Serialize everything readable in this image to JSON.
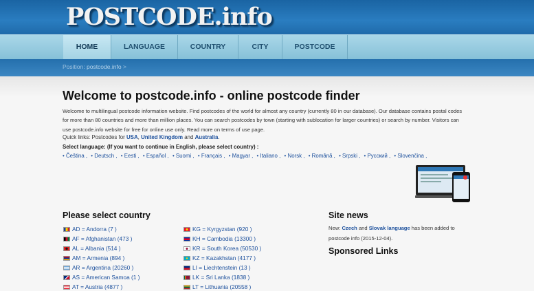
{
  "logo": "POSTCODE.info",
  "nav": [
    {
      "label": "HOME"
    },
    {
      "label": "LANGUAGE"
    },
    {
      "label": "COUNTRY"
    },
    {
      "label": "CITY"
    },
    {
      "label": "POSTCODE"
    }
  ],
  "breadcrumb": {
    "prefix": "Position:",
    "link": "postcode.info",
    "sep": ">"
  },
  "heading": "Welcome to postcode.info - online postcode finder",
  "intro": "Welcome to multilingual postcode information website. Find postcodes of the world for almost any country (currently 80 in our database). Our database contains postal codes for more than 80 countries and more than million places. You can search postcodes by town (starting with sublocation for larger countries) or search by number. Visitors can use postcode.info website for free for online use only. Read more on terms of use page.",
  "quick_links": {
    "prefix": "Quick links: Postcodes for",
    "usa": "USA",
    "uk": "United Kingdom",
    "and": "and",
    "aus": "Australia",
    "end": "."
  },
  "select_language": "Select language: (If you want to continue in English, please select country) :",
  "languages": [
    {
      "label": "• Čeština ,"
    },
    {
      "label": "• Deutsch ,"
    },
    {
      "label": "• Eesti ,"
    },
    {
      "label": "• Español ,"
    },
    {
      "label": "• Suomi ,"
    },
    {
      "label": "• Français ,"
    },
    {
      "label": "• Magyar ,"
    },
    {
      "label": "• Italiano ,"
    },
    {
      "label": "• Norsk ,"
    },
    {
      "label": "• Română ,"
    },
    {
      "label": "• Srpski ,"
    },
    {
      "label": "• Русский ,"
    },
    {
      "label": "• Slovenčina ,"
    }
  ],
  "country_heading": "Please select country",
  "countries_left": [
    {
      "label": "AD = Andorra (7 )",
      "c1": "#1a3fa0",
      "c2": "#f2d200",
      "c3": "#d21f26"
    },
    {
      "label": "AF = Afghanistan (473 )",
      "c1": "#000000",
      "c2": "#c8102e",
      "c3": "#007a36"
    },
    {
      "label": "AL = Albania (514 )",
      "c1": "#e41e20",
      "c2": "#1a1a1a",
      "c3": "#e41e20"
    },
    {
      "label": "AM = Armenia (894 )",
      "c1": "#d90012",
      "c2": "#0033a0",
      "c3": "#f2a800"
    },
    {
      "label": "AR = Argentina (20260 )",
      "c1": "#74acdf",
      "c2": "#ffffff",
      "c3": "#74acdf"
    },
    {
      "label": "AS = American Samoa (1 )",
      "c1": "#002b7f",
      "c2": "#ffffff",
      "c3": "#c8102e"
    },
    {
      "label": "AT = Austria (4877 )",
      "c1": "#ed2939",
      "c2": "#ffffff",
      "c3": "#ed2939"
    }
  ],
  "countries_right": [
    {
      "label": "KG = Kyrgyzstan (920 )",
      "c1": "#e8112d",
      "c2": "#f5d800",
      "c3": "#e8112d"
    },
    {
      "label": "KH = Cambodia (13300 )",
      "c1": "#032ea1",
      "c2": "#e00025",
      "c3": "#032ea1"
    },
    {
      "label": "KR = South Korea (50530 )",
      "c1": "#ffffff",
      "c2": "#c60c30",
      "c3": "#003478"
    },
    {
      "label": "KZ = Kazakhstan (4177 )",
      "c1": "#00afca",
      "c2": "#fec50c",
      "c3": "#00afca"
    },
    {
      "label": "LI = Liechtenstein (13 )",
      "c1": "#002b7f",
      "c2": "#ce1126",
      "c3": "#ce1126"
    },
    {
      "label": "LK = Sri Lanka (1838 )",
      "c1": "#f7b718",
      "c2": "#8d153a",
      "c3": "#eb7400"
    },
    {
      "label": "LT = Lithuania (20558 )",
      "c1": "#fdb913",
      "c2": "#006a44",
      "c3": "#c1272d"
    }
  ],
  "news_heading": "Site news",
  "news": {
    "prefix": "New:",
    "czech": "Czech",
    "and": "and",
    "slovak": "Slovak language",
    "suffix": "has been added to postcode info (2015-12-04)."
  },
  "sponsored_heading": "Sponsored Links"
}
